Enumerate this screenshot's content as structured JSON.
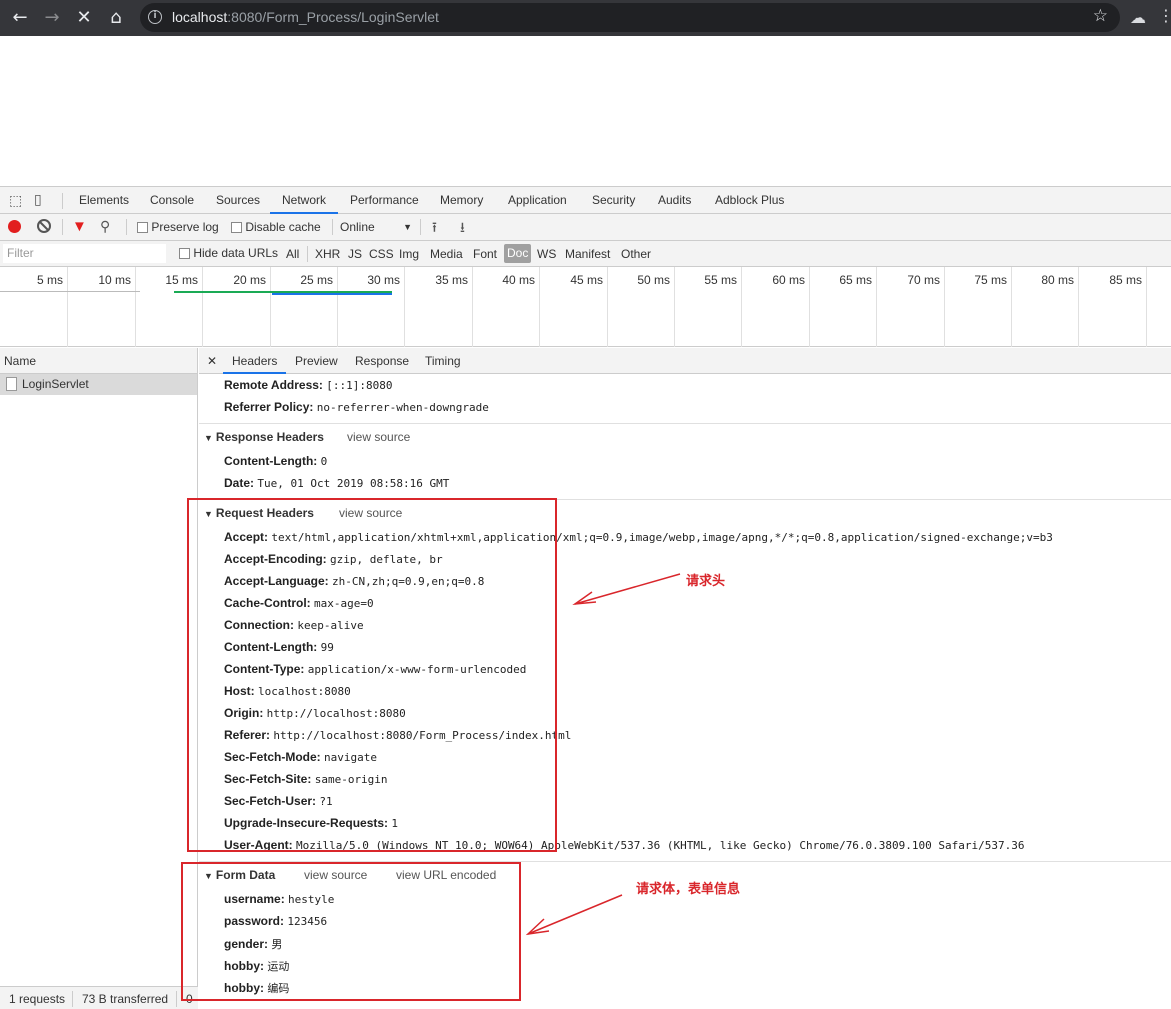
{
  "browser": {
    "url_host": "localhost",
    "url_rest": ":8080/Form_Process/LoginServlet"
  },
  "devtools": {
    "tabs": [
      "Elements",
      "Console",
      "Sources",
      "Network",
      "Performance",
      "Memory",
      "Application",
      "Security",
      "Audits",
      "Adblock Plus"
    ],
    "active_tab": "Network",
    "toolbar": {
      "preserve_log": "Preserve log",
      "disable_cache": "Disable cache",
      "throttle": "Online"
    },
    "filter": {
      "placeholder": "Filter",
      "hide_data_urls": "Hide data URLs",
      "types": [
        "All",
        "XHR",
        "JS",
        "CSS",
        "Img",
        "Media",
        "Font",
        "Doc",
        "WS",
        "Manifest",
        "Other"
      ],
      "active_type": "Doc"
    },
    "timeline_ticks": [
      "5 ms",
      "10 ms",
      "15 ms",
      "20 ms",
      "25 ms",
      "30 ms",
      "35 ms",
      "40 ms",
      "45 ms",
      "50 ms",
      "55 ms",
      "60 ms",
      "65 ms",
      "70 ms",
      "75 ms",
      "80 ms",
      "85 ms"
    ],
    "name_col": {
      "header": "Name",
      "request": "LoginServlet"
    },
    "status": {
      "requests": "1 requests",
      "transferred": "73 B transferred",
      "extra": "0"
    },
    "detail_tabs": [
      "Headers",
      "Preview",
      "Response",
      "Timing"
    ],
    "general": [
      {
        "k": "Remote Address:",
        "v": "[::1]:8080"
      },
      {
        "k": "Referrer Policy:",
        "v": "no-referrer-when-downgrade"
      }
    ],
    "response_headers": {
      "title": "Response Headers",
      "view_source": "view source",
      "items": [
        {
          "k": "Content-Length:",
          "v": "0"
        },
        {
          "k": "Date:",
          "v": "Tue, 01 Oct 2019 08:58:16 GMT"
        }
      ]
    },
    "request_headers": {
      "title": "Request Headers",
      "view_source": "view source",
      "items": [
        {
          "k": "Accept:",
          "v": "text/html,application/xhtml+xml,application/xml;q=0.9,image/webp,image/apng,*/*;q=0.8,application/signed-exchange;v=b3"
        },
        {
          "k": "Accept-Encoding:",
          "v": "gzip, deflate, br"
        },
        {
          "k": "Accept-Language:",
          "v": "zh-CN,zh;q=0.9,en;q=0.8"
        },
        {
          "k": "Cache-Control:",
          "v": "max-age=0"
        },
        {
          "k": "Connection:",
          "v": "keep-alive"
        },
        {
          "k": "Content-Length:",
          "v": "99"
        },
        {
          "k": "Content-Type:",
          "v": "application/x-www-form-urlencoded"
        },
        {
          "k": "Host:",
          "v": "localhost:8080"
        },
        {
          "k": "Origin:",
          "v": "http://localhost:8080"
        },
        {
          "k": "Referer:",
          "v": "http://localhost:8080/Form_Process/index.html"
        },
        {
          "k": "Sec-Fetch-Mode:",
          "v": "navigate"
        },
        {
          "k": "Sec-Fetch-Site:",
          "v": "same-origin"
        },
        {
          "k": "Sec-Fetch-User:",
          "v": "?1"
        },
        {
          "k": "Upgrade-Insecure-Requests:",
          "v": "1"
        },
        {
          "k": "User-Agent:",
          "v": "Mozilla/5.0 (Windows NT 10.0; WOW64) AppleWebKit/537.36 (KHTML, like Gecko) Chrome/76.0.3809.100 Safari/537.36"
        }
      ]
    },
    "form_data": {
      "title": "Form Data",
      "view_source": "view source",
      "view_url_encoded": "view URL encoded",
      "items": [
        {
          "k": "username:",
          "v": "hestyle"
        },
        {
          "k": "password:",
          "v": "123456"
        },
        {
          "k": "gender:",
          "v": "男"
        },
        {
          "k": "hobby:",
          "v": "运动"
        },
        {
          "k": "hobby:",
          "v": "编码"
        }
      ]
    }
  },
  "annotations": {
    "request_header": "请求头",
    "request_body": "请求体，表单信息"
  },
  "colors": {
    "annotation": "#d9262b",
    "accent": "#1a73e8"
  }
}
